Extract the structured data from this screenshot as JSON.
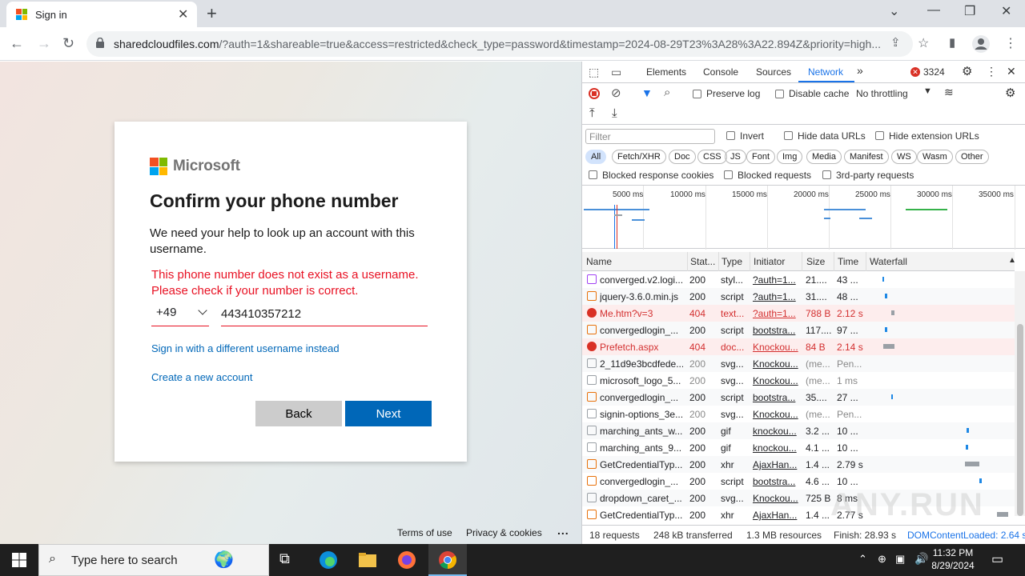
{
  "browser": {
    "tab_title": "Sign in",
    "url_domain": "sharedcloudfiles.com",
    "url_rest": "/?auth=1&shareable=true&access=restricted&check_type=password&timestamp=2024-08-29T23%3A28%3A22.894Z&priority=high..."
  },
  "signin": {
    "brand": "Microsoft",
    "heading": "Confirm your phone number",
    "description": "We need your help to look up an account with this username.",
    "error": "This phone number does not exist as a username. Please check if your number is correct.",
    "country_code": "+49",
    "phone_value": "443410357212",
    "different_username_link": "Sign in with a different username instead",
    "create_account_link": "Create a new account",
    "back_label": "Back",
    "next_label": "Next",
    "footer_terms": "Terms of use",
    "footer_privacy": "Privacy & cookies",
    "footer_more": "..."
  },
  "devtools": {
    "tabs": [
      "Elements",
      "Console",
      "Sources",
      "Network"
    ],
    "error_count": "3324",
    "preserve_log": "Preserve log",
    "disable_cache": "Disable cache",
    "throttling": "No throttling",
    "filter_placeholder": "Filter",
    "invert": "Invert",
    "hide_data_urls": "Hide data URLs",
    "hide_extension_urls": "Hide extension URLs",
    "type_filters": [
      "All",
      "Fetch/XHR",
      "Doc",
      "CSS",
      "JS",
      "Font",
      "Img",
      "Media",
      "Manifest",
      "WS",
      "Wasm",
      "Other"
    ],
    "blocked_cookies": "Blocked response cookies",
    "blocked_requests": "Blocked requests",
    "third_party": "3rd-party requests",
    "timeline_ticks": [
      "5000 ms",
      "10000 ms",
      "15000 ms",
      "20000 ms",
      "25000 ms",
      "30000 ms",
      "35000 ms"
    ],
    "columns": [
      "Name",
      "Stat...",
      "Type",
      "Initiator",
      "Size",
      "Time",
      "Waterfall"
    ],
    "rows": [
      {
        "name": "converged.v2.logi...",
        "status": "200",
        "type": "styl...",
        "initiator": "?auth=1...",
        "size": "21....",
        "time": "43 ...",
        "kind": "css"
      },
      {
        "name": "jquery-3.6.0.min.js",
        "status": "200",
        "type": "script",
        "initiator": "?auth=1...",
        "size": "31....",
        "time": "48 ...",
        "kind": "js"
      },
      {
        "name": "Me.htm?v=3",
        "status": "404",
        "type": "text...",
        "initiator": "?auth=1...",
        "size": "788 B",
        "time": "2.12 s",
        "kind": "err"
      },
      {
        "name": "convergedlogin_...",
        "status": "200",
        "type": "script",
        "initiator": "bootstra...",
        "size": "117....",
        "time": "97 ...",
        "kind": "js"
      },
      {
        "name": "Prefetch.aspx",
        "status": "404",
        "type": "doc...",
        "initiator": "Knockou...",
        "size": "84 B",
        "time": "2.14 s",
        "kind": "err"
      },
      {
        "name": "2_11d9e3bcdfede...",
        "status": "200",
        "type": "svg...",
        "initiator": "Knockou...",
        "size": "(me...",
        "time": "Pen...",
        "kind": "img"
      },
      {
        "name": "microsoft_logo_5...",
        "status": "200",
        "type": "svg...",
        "initiator": "Knockou...",
        "size": "(me...",
        "time": "1 ms",
        "kind": "img"
      },
      {
        "name": "convergedlogin_...",
        "status": "200",
        "type": "script",
        "initiator": "bootstra...",
        "size": "35....",
        "time": "27 ...",
        "kind": "js"
      },
      {
        "name": "signin-options_3e...",
        "status": "200",
        "type": "svg...",
        "initiator": "Knockou...",
        "size": "(me...",
        "time": "Pen...",
        "kind": "img"
      },
      {
        "name": "marching_ants_w...",
        "status": "200",
        "type": "gif",
        "initiator": "knockou...",
        "size": "3.2 ...",
        "time": "10 ...",
        "kind": "img"
      },
      {
        "name": "marching_ants_9...",
        "status": "200",
        "type": "gif",
        "initiator": "knockou...",
        "size": "4.1 ...",
        "time": "10 ...",
        "kind": "img"
      },
      {
        "name": "GetCredentialTyp...",
        "status": "200",
        "type": "xhr",
        "initiator": "AjaxHan...",
        "size": "1.4 ...",
        "time": "2.79 s",
        "kind": "xhr"
      },
      {
        "name": "convergedlogin_...",
        "status": "200",
        "type": "script",
        "initiator": "bootstra...",
        "size": "4.6 ...",
        "time": "10 ...",
        "kind": "js"
      },
      {
        "name": "dropdown_caret_...",
        "status": "200",
        "type": "svg...",
        "initiator": "Knockou...",
        "size": "725 B",
        "time": "8 ms",
        "kind": "img"
      },
      {
        "name": "GetCredentialTyp...",
        "status": "200",
        "type": "xhr",
        "initiator": "AjaxHan...",
        "size": "1.4 ...",
        "time": "2.77 s",
        "kind": "xhr"
      }
    ],
    "status": {
      "requests": "18 requests",
      "transferred": "248 kB transferred",
      "resources": "1.3 MB resources",
      "finish": "Finish: 28.93 s",
      "dcl": "DOMContentLoaded: 2.64 s"
    }
  },
  "taskbar": {
    "search_placeholder": "Type here to search",
    "time": "11:32 PM",
    "date": "8/29/2024"
  },
  "watermark": "ANY.RUN"
}
